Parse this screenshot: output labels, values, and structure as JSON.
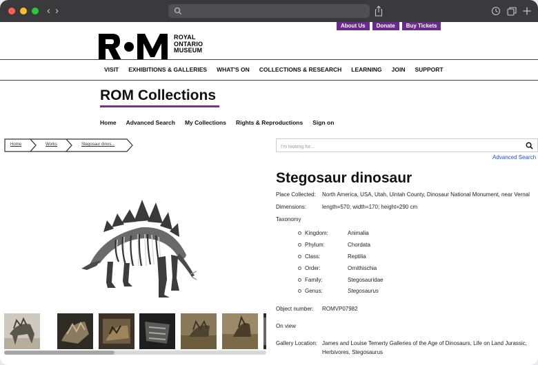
{
  "browser": {
    "url": ""
  },
  "site": {
    "top_buttons": [
      "About Us",
      "Donate",
      "Buy Tickets"
    ],
    "logo_text": [
      "ROYAL",
      "ONTARIO",
      "MUSEUM"
    ],
    "main_nav": [
      "VISIT",
      "EXHIBITIONS & GALLERIES",
      "WHAT'S ON",
      "COLLECTIONS & RESEARCH",
      "LEARNING",
      "JOIN",
      "SUPPORT"
    ],
    "collections_title": "ROM Collections",
    "sub_nav": [
      "Home",
      "Advanced Search",
      "My Collections",
      "Rights & Reproductions",
      "Sign on"
    ],
    "accent_color": "#7a2e96"
  },
  "breadcrumb": [
    "Home",
    "Works",
    "Stegosaur dinos..."
  ],
  "search": {
    "placeholder": "I'm looking for...",
    "advanced_label": "Advanced Search"
  },
  "object": {
    "title": "Stegosaur dinosaur",
    "place_collected_label": "Place Collected:",
    "place_collected": "North America, USA, Utah, Uintah County, Dinosaur National Monument, near Vernal",
    "dimensions_label": "Dimensions:",
    "dimensions": "length=570; width=170; height=290 cm",
    "taxonomy_label": "Taxonomy",
    "taxonomy": [
      {
        "label": "Kingdom:",
        "value": "Animalia"
      },
      {
        "label": "Phylum:",
        "value": "Chordata"
      },
      {
        "label": "Class:",
        "value": "Reptilia"
      },
      {
        "label": "Order:",
        "value": "Ornithischia"
      },
      {
        "label": "Family:",
        "value": "Stegosauridae"
      },
      {
        "label": "Genus:",
        "value": "Stegosaurus"
      }
    ],
    "object_number_label": "Object number:",
    "object_number": "ROMVP07982",
    "on_view": "On view",
    "gallery_label": "Gallery Location:",
    "gallery_line1": "James and Louise Temerty Galleries of the Age of Dinosaurs, Life on Land Jurassic,",
    "gallery_line2": "Herbivores, Stegosaurus"
  },
  "thumbnails": [
    "thumbnail-1",
    "thumbnail-2",
    "thumbnail-3",
    "thumbnail-4",
    "thumbnail-5",
    "thumbnail-6",
    "thumbnail-7"
  ],
  "thumbnail_scroll_fraction": 0.42
}
